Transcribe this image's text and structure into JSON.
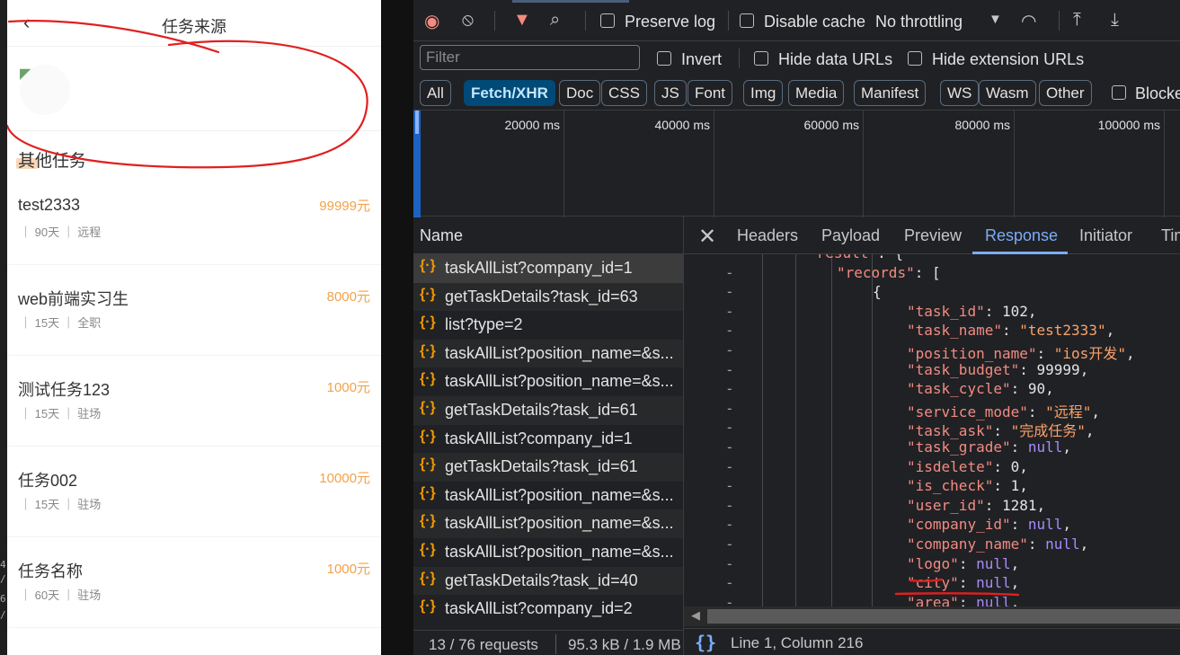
{
  "mobile": {
    "title": "任务来源",
    "back_icon": "chevron-left-icon",
    "other_tasks_heading": "其他任务",
    "tasks": [
      {
        "name": "test2333",
        "price": "99999元",
        "meta": "｜ 90天 ｜ 远程"
      },
      {
        "name": "web前端实习生",
        "price": "8000元",
        "meta": "｜ 15天 ｜ 全职"
      },
      {
        "name": "测试任务123",
        "price": "1000元",
        "meta": "｜ 15天 ｜ 驻场"
      },
      {
        "name": "任务002",
        "price": "10000元",
        "meta": "｜ 15天 ｜ 驻场"
      },
      {
        "name": "任务名称",
        "price": "1000元",
        "meta": "｜ 60天 ｜ 驻场"
      }
    ],
    "annotation_color": "#e02020",
    "price_color": "#f2a24a"
  },
  "left_strip": {
    "chars": [
      "4",
      "/",
      "6",
      "/"
    ]
  },
  "toolbar": {
    "record_icon": "stop-recording-icon",
    "clear_icon": "clear-icon",
    "filter_icon": "funnel-icon",
    "search_icon": "search-icon",
    "preserve_log": "Preserve log",
    "disable_cache": "Disable cache",
    "throttling": "No throttling",
    "dropdown_icon": "caret-down-icon",
    "wifi_icon": "network-conditions-icon",
    "upload_icon": "upload-icon",
    "download_icon": "download-icon"
  },
  "filter_bar": {
    "placeholder": "Filter",
    "invert": "Invert",
    "hide_data_urls": "Hide data URLs",
    "hide_ext_urls": "Hide extension URLs"
  },
  "type_filters": [
    "All",
    "Fetch/XHR",
    "Doc",
    "CSS",
    "JS",
    "Font",
    "Img",
    "Media",
    "Manifest",
    "WS",
    "Wasm",
    "Other"
  ],
  "type_filter_active": "Fetch/XHR",
  "blocked_label": "Blocke",
  "timeline": {
    "labels": [
      "20000 ms",
      "40000 ms",
      "60000 ms",
      "80000 ms",
      "100000 ms"
    ]
  },
  "requests": {
    "header": "Name",
    "items": [
      "taskAllList?company_id=1",
      "getTaskDetails?task_id=63",
      "list?type=2",
      "taskAllList?position_name=&s...",
      "taskAllList?position_name=&s...",
      "getTaskDetails?task_id=61",
      "taskAllList?company_id=1",
      "getTaskDetails?task_id=61",
      "taskAllList?position_name=&s...",
      "taskAllList?position_name=&s...",
      "taskAllList?position_name=&s...",
      "getTaskDetails?task_id=40",
      "taskAllList?company_id=2"
    ],
    "icon": "fetch-braces-icon",
    "status_requests": "13 / 76 requests",
    "status_size": "95.3 kB / 1.9 MB"
  },
  "detail": {
    "tabs": [
      "Headers",
      "Payload",
      "Preview",
      "Response",
      "Initiator",
      "Timing"
    ],
    "active_tab": "Response",
    "close_icon": "close-icon",
    "status_icon": "braces-icon",
    "status_icon_text": "{}",
    "cursor_pos": "Line 1, Column 216",
    "response_lines": [
      {
        "indent": 0,
        "key": "result",
        "sep": ": {",
        "val": "",
        "t": "punc"
      },
      {
        "indent": 1,
        "key": "records",
        "sep": ": [",
        "val": "",
        "t": "punc"
      },
      {
        "indent": 2,
        "key": "",
        "sep": "{",
        "val": "",
        "t": "punc"
      },
      {
        "indent": 3,
        "key": "task_id",
        "sep": ": ",
        "val": "102",
        "t": "num"
      },
      {
        "indent": 3,
        "key": "task_name",
        "sep": ": ",
        "val": "\"test2333\"",
        "t": "str"
      },
      {
        "indent": 3,
        "key": "position_name",
        "sep": ": ",
        "val": "\"ios开发\"",
        "t": "str"
      },
      {
        "indent": 3,
        "key": "task_budget",
        "sep": ": ",
        "val": "99999",
        "t": "num"
      },
      {
        "indent": 3,
        "key": "task_cycle",
        "sep": ": ",
        "val": "90",
        "t": "num"
      },
      {
        "indent": 3,
        "key": "service_mode",
        "sep": ": ",
        "val": "\"远程\"",
        "t": "str"
      },
      {
        "indent": 3,
        "key": "task_ask",
        "sep": ": ",
        "val": "\"完成任务\"",
        "t": "str"
      },
      {
        "indent": 3,
        "key": "task_grade",
        "sep": ": ",
        "val": "null",
        "t": "nul"
      },
      {
        "indent": 3,
        "key": "isdelete",
        "sep": ": ",
        "val": "0",
        "t": "num"
      },
      {
        "indent": 3,
        "key": "is_check",
        "sep": ": ",
        "val": "1",
        "t": "num"
      },
      {
        "indent": 3,
        "key": "user_id",
        "sep": ": ",
        "val": "1281",
        "t": "num"
      },
      {
        "indent": 3,
        "key": "company_id",
        "sep": ": ",
        "val": "null",
        "t": "nul"
      },
      {
        "indent": 3,
        "key": "company_name",
        "sep": ": ",
        "val": "null",
        "t": "nul"
      },
      {
        "indent": 3,
        "key": "logo",
        "sep": ": ",
        "val": "null",
        "t": "nul"
      },
      {
        "indent": 3,
        "key": "city",
        "sep": ": ",
        "val": "null",
        "t": "nul"
      },
      {
        "indent": 3,
        "key": "area",
        "sep": ": ",
        "val": "null",
        "t": "nul"
      }
    ]
  }
}
